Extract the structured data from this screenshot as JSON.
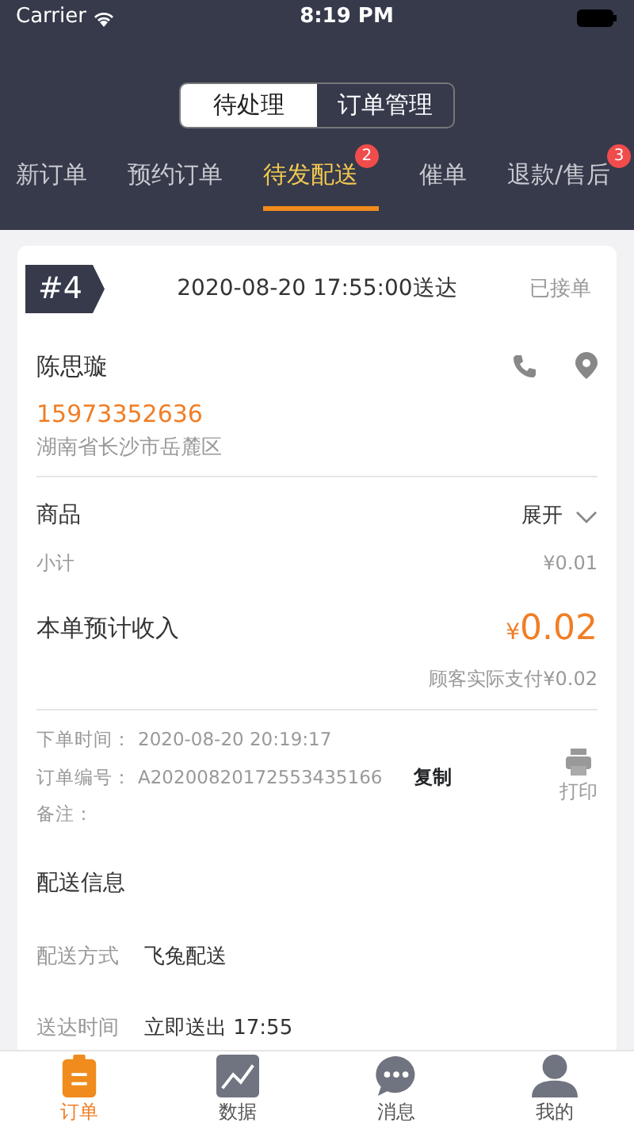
{
  "status_bar": {
    "carrier": "Carrier",
    "time": "8:19 PM"
  },
  "segments": [
    {
      "label": "待处理",
      "selected": true
    },
    {
      "label": "订单管理",
      "selected": false
    }
  ],
  "tabs": [
    {
      "label": "新订单",
      "selected": false
    },
    {
      "label": "预约订单",
      "selected": false
    },
    {
      "label": "待发配送",
      "selected": true,
      "badge": "2"
    },
    {
      "label": "催单",
      "selected": false
    },
    {
      "label": "退款/售后",
      "selected": false,
      "badge": "3"
    }
  ],
  "order": {
    "number": "#4",
    "delivery_time": "2020-08-20 17:55:00送达",
    "status": "已接单",
    "customer": {
      "name": "陈思璇",
      "phone": "15973352636",
      "address": "湖南省长沙市岳麓区"
    },
    "goods": {
      "label": "商品",
      "toggle": "展开",
      "expanded": false
    },
    "subtotal": {
      "label": "小计",
      "value": "¥0.01"
    },
    "income": {
      "label": "本单预计收入",
      "currency": "¥",
      "value": "0.02"
    },
    "paid": "顾客实际支付¥0.02",
    "meta": [
      {
        "label": "下单时间：",
        "value": "2020-08-20 20:19:17"
      },
      {
        "label": "订单编号：",
        "value": "A20200820172553435166",
        "action": "复制"
      },
      {
        "label": "备注："
      }
    ],
    "print": "打印",
    "delivery": {
      "title": "配送信息",
      "rows": [
        {
          "label": "配送方式",
          "value": "飞兔配送"
        },
        {
          "label": "送达时间",
          "value": "立即送出 17:55"
        }
      ]
    }
  },
  "bottom_nav": [
    {
      "label": "订单",
      "selected": true
    },
    {
      "label": "数据",
      "selected": false
    },
    {
      "label": "消息",
      "selected": false
    },
    {
      "label": "我的",
      "selected": false
    }
  ]
}
